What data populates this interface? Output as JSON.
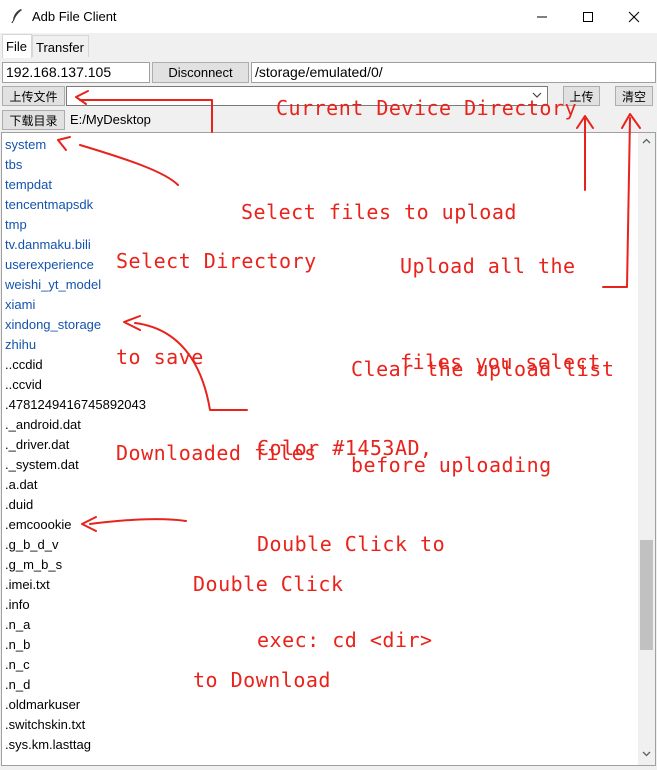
{
  "window": {
    "title": "Adb File Client",
    "controls": {
      "minimize": "–",
      "maximize": "☐",
      "close": "✕"
    }
  },
  "tabs": [
    {
      "label": "File",
      "active": true
    },
    {
      "label": "Transfer",
      "active": false
    }
  ],
  "connection": {
    "ip": "192.168.137.105",
    "disconnect_label": "Disconnect",
    "current_dir": "/storage/emulated/0/"
  },
  "upload": {
    "select_button": "上传文件",
    "upload_button": "上传",
    "clear_button": "清空"
  },
  "download": {
    "dir_button": "下载目录",
    "dir_path": "E:/MyDesktop"
  },
  "colors": {
    "dir_color": "#1453AD",
    "file_color": "#000000",
    "annotation_color": "#e8231c"
  },
  "file_list": [
    {
      "name": "system",
      "type": "dir"
    },
    {
      "name": "tbs",
      "type": "dir"
    },
    {
      "name": "tempdat",
      "type": "dir"
    },
    {
      "name": "tencentmapsdk",
      "type": "dir"
    },
    {
      "name": "tmp",
      "type": "dir"
    },
    {
      "name": "tv.danmaku.bili",
      "type": "dir"
    },
    {
      "name": "userexperience",
      "type": "dir"
    },
    {
      "name": "weishi_yt_model",
      "type": "dir"
    },
    {
      "name": "xiami",
      "type": "dir"
    },
    {
      "name": "xindong_storage",
      "type": "dir"
    },
    {
      "name": "zhihu",
      "type": "dir"
    },
    {
      "name": "..ccdid",
      "type": "file"
    },
    {
      "name": "..ccvid",
      "type": "file"
    },
    {
      "name": ".4781249416745892043",
      "type": "file"
    },
    {
      "name": "._android.dat",
      "type": "file"
    },
    {
      "name": "._driver.dat",
      "type": "file"
    },
    {
      "name": "._system.dat",
      "type": "file"
    },
    {
      "name": ".a.dat",
      "type": "file"
    },
    {
      "name": ".duid",
      "type": "file"
    },
    {
      "name": ".emcoookie",
      "type": "file"
    },
    {
      "name": ".g_b_d_v",
      "type": "file"
    },
    {
      "name": ".g_m_b_s",
      "type": "file"
    },
    {
      "name": ".imei.txt",
      "type": "file"
    },
    {
      "name": ".info",
      "type": "file"
    },
    {
      "name": ".n_a",
      "type": "file"
    },
    {
      "name": ".n_b",
      "type": "file"
    },
    {
      "name": ".n_c",
      "type": "file"
    },
    {
      "name": ".n_d",
      "type": "file"
    },
    {
      "name": ".oldmarkuser",
      "type": "file"
    },
    {
      "name": ".switchskin.txt",
      "type": "file"
    },
    {
      "name": ".sys.km.lasttag",
      "type": "file"
    }
  ],
  "annotations": {
    "current_dir": [
      "Current Device Directory"
    ],
    "select_files": [
      "Select files to upload"
    ],
    "select_dir": [
      "Select Directory",
      "to save",
      "Downloaded files"
    ],
    "upload_all": [
      "Upload all the",
      "files you select"
    ],
    "clear_list": [
      "Clear the upload list",
      "before uploading"
    ],
    "color_note": [
      "Color #1453AD,",
      "Double Click to",
      "exec: cd <dir>"
    ],
    "double_click": [
      "Double Click",
      "to Download"
    ]
  }
}
